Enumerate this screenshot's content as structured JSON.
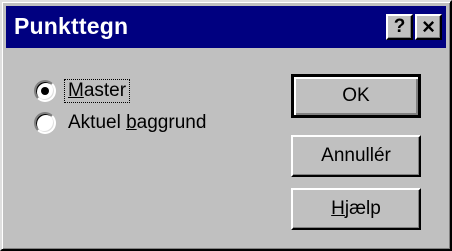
{
  "window": {
    "title": "Punkttegn",
    "help_button": "?",
    "close_button": "×"
  },
  "options": [
    {
      "label_before": "",
      "label_accel": "M",
      "label_after": "aster",
      "selected": true
    },
    {
      "label_before": "Aktuel ",
      "label_accel": "b",
      "label_after": "aggrund",
      "selected": false
    }
  ],
  "buttons": {
    "ok": "OK",
    "cancel": "Annullér",
    "help_before": "",
    "help_accel": "H",
    "help_after": "jælp"
  }
}
